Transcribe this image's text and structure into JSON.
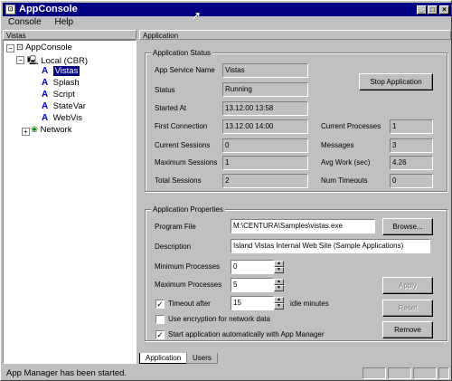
{
  "window": {
    "title": "AppConsole"
  },
  "menu": [
    "Console",
    "Help"
  ],
  "left_header": "Vistas",
  "right_header": "Application",
  "tree": {
    "root": "AppConsole",
    "local": "Local (CBR)",
    "apps": [
      "Vistas",
      "Splash",
      "Script",
      "StateVar",
      "WebVis"
    ],
    "network": "Network",
    "selected": "Vistas"
  },
  "status_group": {
    "title": "Application Status",
    "app_service_name_label": "App Service Name",
    "app_service_name": "Vistas",
    "status_label": "Status",
    "status": "Running",
    "started_at_label": "Started At",
    "started_at": "13.12.00 13:58",
    "first_connection_label": "First Connection",
    "first_connection": "13.12.00 14:00",
    "current_sessions_label": "Current Sessions",
    "current_sessions": "0",
    "maximum_sessions_label": "Maximum Sessions",
    "maximum_sessions": "1",
    "total_sessions_label": "Total Sessions",
    "total_sessions": "2",
    "current_processes_label": "Current Processes",
    "current_processes": "1",
    "messages_label": "Messages",
    "messages": "3",
    "avg_work_label": "Avg Work (sec)",
    "avg_work": "4.26",
    "num_timeouts_label": "Num Timeouts",
    "num_timeouts": "0",
    "stop_button": "Stop Application"
  },
  "properties_group": {
    "title": "Application Properties",
    "program_file_label": "Program File",
    "program_file": "M:\\CENTURA\\Samples\\vistas.exe",
    "browse_button": "Browse...",
    "description_label": "Description",
    "description": "Island Vistas Internal Web Site (Sample Applications)",
    "min_processes_label": "Minimum Processes",
    "min_processes": "0",
    "max_processes_label": "Maximum Processes",
    "max_processes": "5",
    "timeout_label": "Timeout after",
    "timeout_value": "15",
    "idle_minutes_label": "idle minutes",
    "encryption_label": "Use encryption for network data",
    "autostart_label": "Start application automatically with App Manager",
    "apply_button": "Apply",
    "reset_button": "Reset",
    "remove_button": "Remove",
    "timeout_checked": true,
    "encryption_checked": false,
    "autostart_checked": true
  },
  "tabs": [
    "Application",
    "Users"
  ],
  "statusbar": {
    "message": "App Manager has been started."
  }
}
